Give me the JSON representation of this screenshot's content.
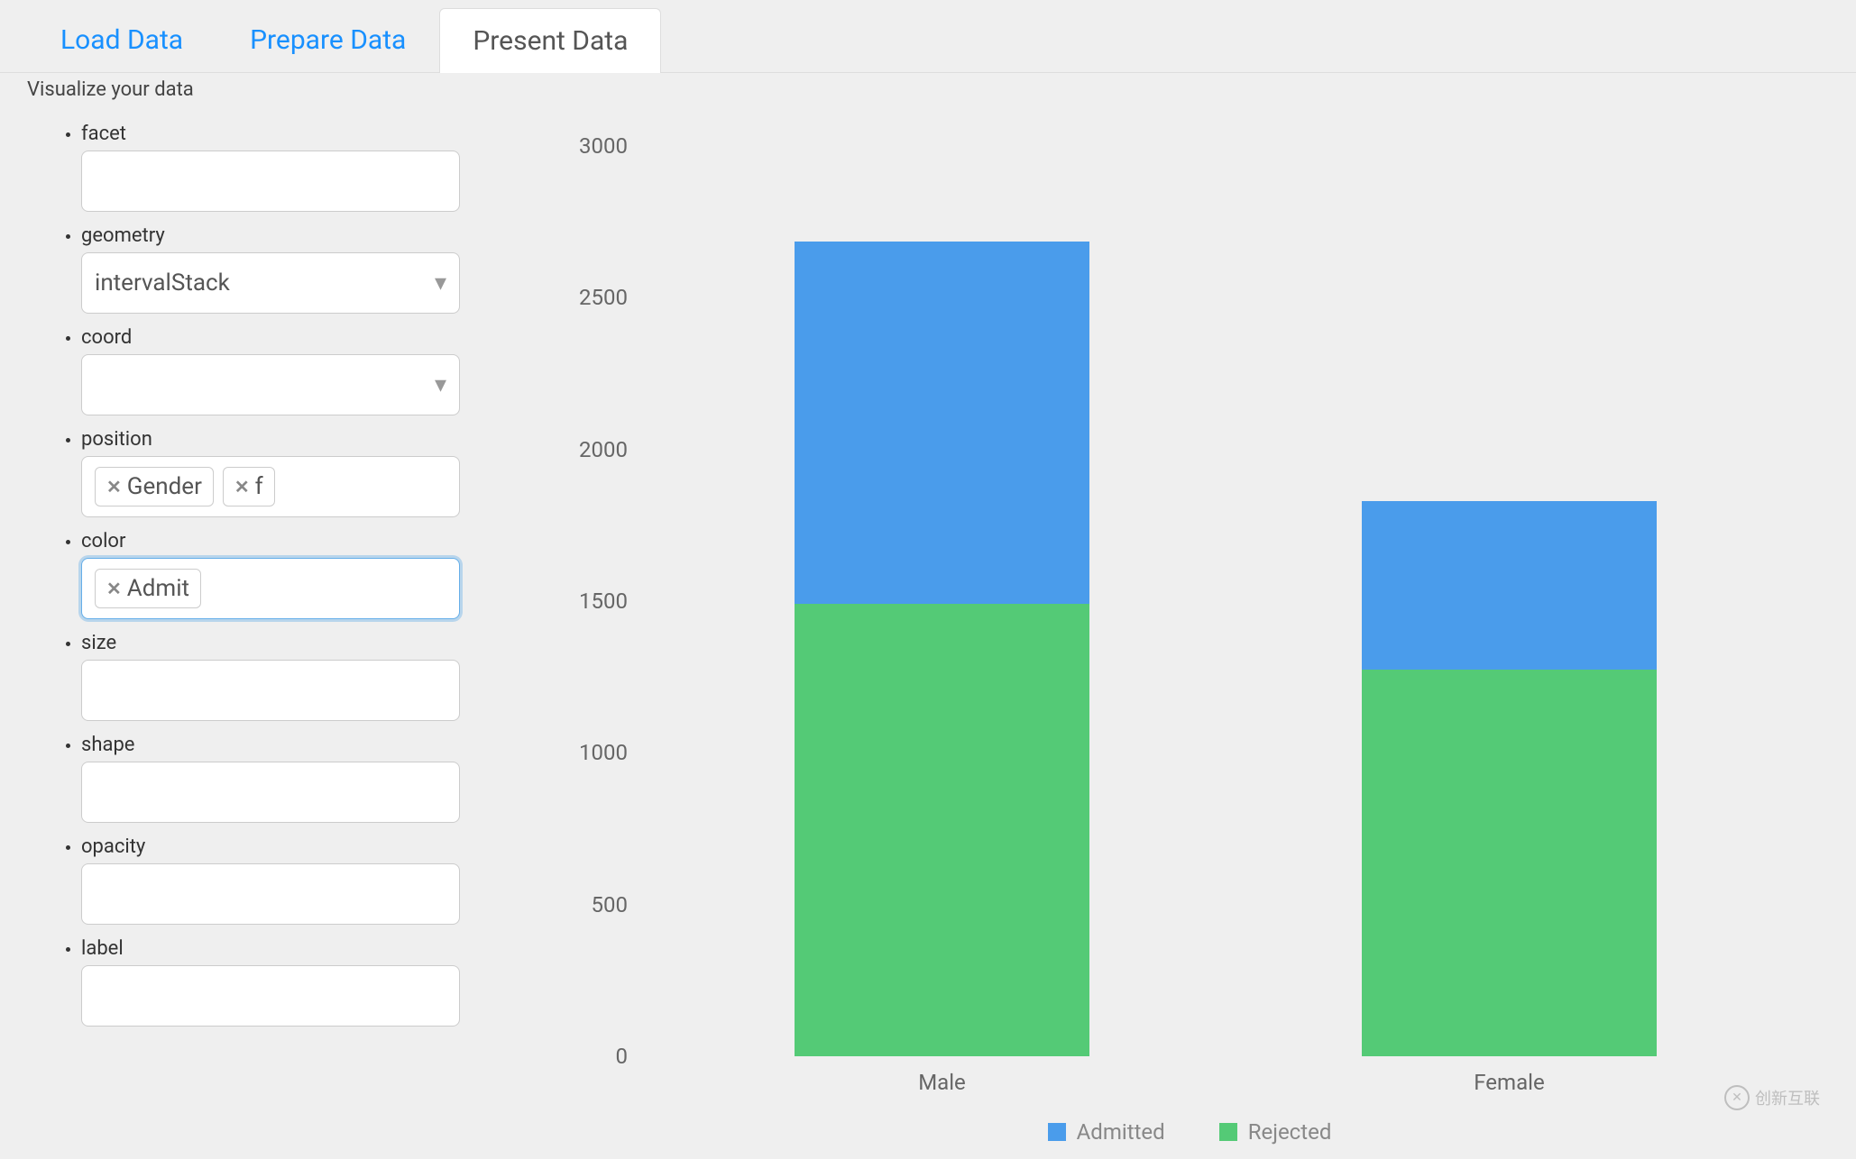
{
  "tabs": {
    "load": "Load Data",
    "prepare": "Prepare Data",
    "present": "Present Data",
    "active": "present"
  },
  "subheader": "Visualize your data",
  "form": {
    "facet": {
      "label": "facet",
      "value": ""
    },
    "geometry": {
      "label": "geometry",
      "value": "intervalStack"
    },
    "coord": {
      "label": "coord",
      "value": ""
    },
    "position": {
      "label": "position",
      "tags": [
        "Gender",
        "f"
      ]
    },
    "color": {
      "label": "color",
      "tags": [
        "Admit"
      ],
      "focused": true
    },
    "size": {
      "label": "size",
      "value": ""
    },
    "shape": {
      "label": "shape",
      "value": ""
    },
    "opacity": {
      "label": "opacity",
      "value": ""
    },
    "label": {
      "label": "label",
      "value": ""
    }
  },
  "chart_data": {
    "type": "bar",
    "stacked": true,
    "title": "",
    "xlabel": "",
    "ylabel": "",
    "ylim": [
      0,
      3000
    ],
    "yticks": [
      0,
      500,
      1000,
      1500,
      2000,
      2500,
      3000
    ],
    "categories": [
      "Male",
      "Female"
    ],
    "series": [
      {
        "name": "Rejected",
        "color": "#54ca76",
        "values": [
          1490,
          1275
        ]
      },
      {
        "name": "Admitted",
        "color": "#4a9ceb",
        "values": [
          1195,
          555
        ]
      }
    ],
    "legend": [
      {
        "name": "Admitted",
        "color": "#4a9ceb"
      },
      {
        "name": "Rejected",
        "color": "#54ca76"
      }
    ]
  },
  "watermark": "创新互联"
}
